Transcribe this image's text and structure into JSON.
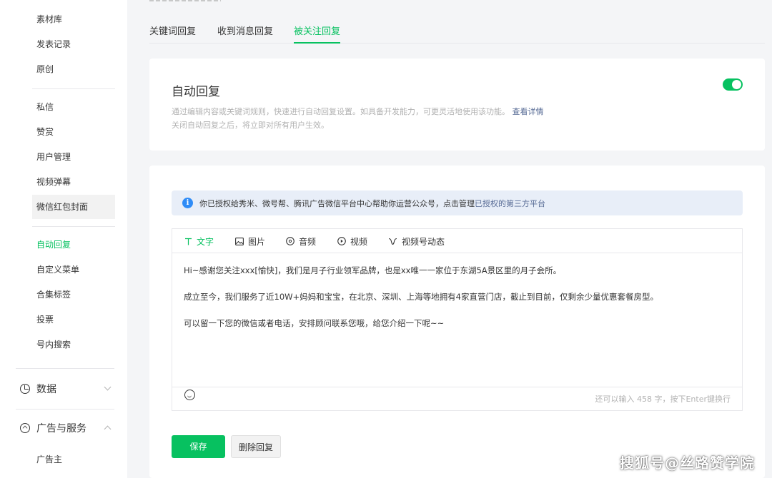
{
  "sidebar": {
    "items_top": [
      "素材库",
      "发表记录",
      "原创"
    ],
    "items_mid": [
      "私信",
      "赞赏",
      "用户管理",
      "视频弹幕",
      "微信红包封面"
    ],
    "items_func": [
      "自动回复",
      "自定义菜单",
      "合集标签",
      "投票",
      "号内搜索"
    ],
    "section_data": "数据",
    "section_ads": "广告与服务",
    "items_ads": [
      "广告主"
    ]
  },
  "tabs": [
    "关键词回复",
    "收到消息回复",
    "被关注回复"
  ],
  "auto_reply": {
    "title": "自动回复",
    "desc_line1": "通过编辑内容或关键词规则，快速进行自动回复设置。如具备开发能力，可更灵活地使用该功能。",
    "desc_link": "查看详情",
    "desc_line2": "关闭自动回复之后，将立即对所有用户生效。",
    "enabled": true
  },
  "notice": {
    "icon": "i",
    "text": "你已授权给秀米、微号帮、腾讯广告微信平台中心帮助你运营公众号，点击管理",
    "link": "已授权的第三方平台"
  },
  "editor": {
    "tools": [
      "文字",
      "图片",
      "音频",
      "视频",
      "视频号动态"
    ],
    "content": [
      "Hi~感谢您关注xxx[愉快]，我们是月子行业领军品牌，也是xx唯一一家位于东湖5A景区里的月子会所。",
      "成立至今，我们服务了近10W+妈妈和宝宝，在北京、深圳、上海等地拥有4家直营门店，截止到目前，仅剩余少量优惠套餐房型。",
      "可以留一下您的微信或者电话，安排顾问联系您哦，给您介绍一下呢~~"
    ],
    "counter": "还可以输入 458 字，按下Enter键换行"
  },
  "buttons": {
    "save": "保存",
    "delete": "删除回复"
  },
  "watermark": "搜狐号@丝路赞学院",
  "colors": {
    "accent": "#07c160",
    "link": "#576b95",
    "notice_bg": "#e8eef8",
    "info_icon": "#2f8cf7"
  }
}
